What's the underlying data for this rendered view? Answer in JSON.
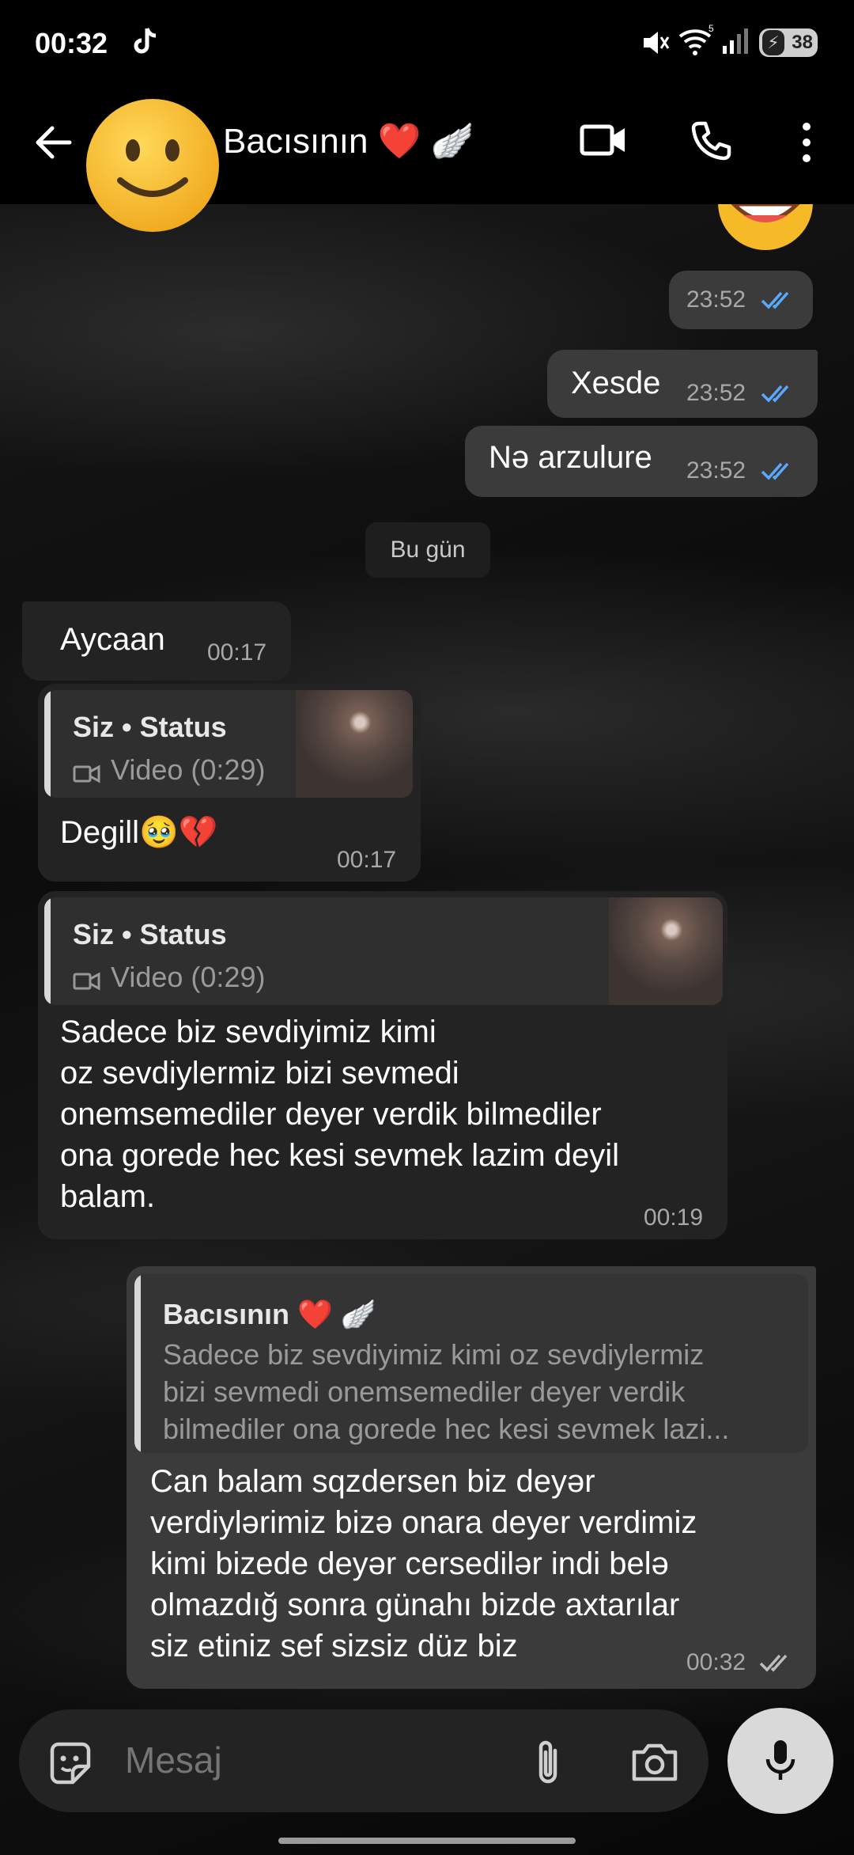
{
  "status_bar": {
    "time": "00:32",
    "battery": "38"
  },
  "header": {
    "contact_name": "Bacısının ❤️ 🪽"
  },
  "messages": [
    {
      "time": "23:52"
    },
    {
      "text": "Xesde",
      "time": "23:52"
    },
    {
      "text": "Nə arzulure",
      "time": "23:52"
    },
    {
      "text": "Aycaan",
      "time": "00:17"
    },
    {
      "reply_title": "Siz • Status",
      "reply_sub": "Video (0:29)",
      "text": "Degill🥹💔",
      "time": "00:17"
    },
    {
      "reply_title": "Siz • Status",
      "reply_sub": "Video (0:29)",
      "lines": [
        "Sadece biz sevdiyimiz kimi",
        "oz sevdiylermiz bizi sevmedi",
        "onemsemediler deyer verdik bilmediler",
        "ona gorede hec kesi sevmek lazim deyil",
        "balam."
      ],
      "time": "00:19"
    },
    {
      "reply_title": "Bacısının ❤️ 🪽",
      "reply_lines": [
        "Sadece biz sevdiyimiz kimi oz sevdiylermiz",
        "bizi sevmedi onemsemediler deyer verdik",
        "bilmediler ona gorede hec kesi sevmek lazi..."
      ],
      "lines": [
        "Can balam sqzdersen biz deyər",
        "verdiylərimiz bizə onara deyer verdimiz",
        "kimi bizede deyər cersedilər indi belə",
        "olmazdığ sonra günahı bizde axtarılar",
        "siz etiniz sef sizsiz düz biz"
      ],
      "time": "00:32"
    }
  ],
  "date_separator": "Bu gün",
  "composer": {
    "placeholder": "Mesaj"
  },
  "colors": {
    "read_ticks": "#5aa9ff",
    "sent_ticks": "#bdbdbd"
  }
}
